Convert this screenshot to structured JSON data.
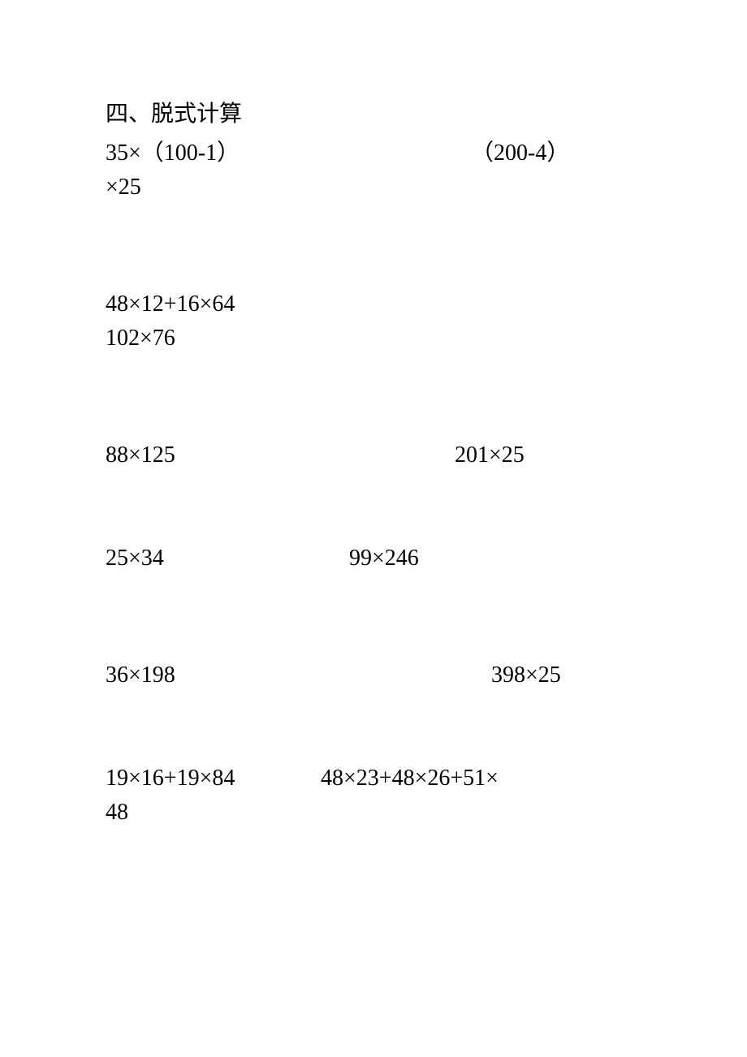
{
  "heading": "四、脱式计算",
  "r1_left_line1": "35×（100-1）",
  "r1_right_line1": "（200-4）",
  "r1_left_line2": "×25",
  "r2_line1": "48×12+16×64",
  "r2_line2": "102×76",
  "r3_left": "88×125",
  "r3_right": "201×25",
  "r4_left": "25×34",
  "r4_right": "99×246",
  "r5_left": "36×198",
  "r5_right": "398×25",
  "r6_left": "19×16+19×84",
  "r6_right": "48×23+48×26+51×",
  "r6_line2": "48"
}
